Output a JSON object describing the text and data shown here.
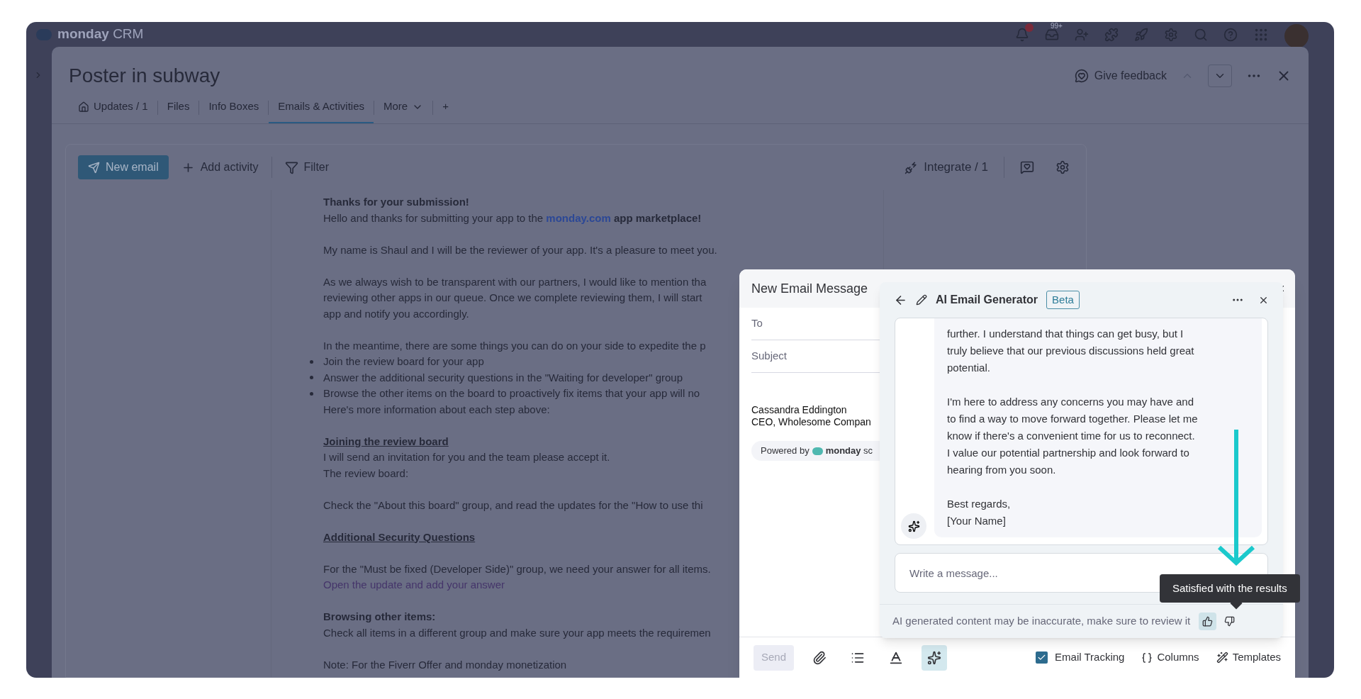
{
  "top_bar": {
    "brand": "monday",
    "product": "CRM",
    "inbox_badge": "99+"
  },
  "item": {
    "title": "Poster in subway",
    "feedback": "Give feedback"
  },
  "tabs": [
    {
      "label": "Updates / 1",
      "selected": false,
      "kind": "home"
    },
    {
      "label": "Files",
      "selected": false,
      "kind": "plain"
    },
    {
      "label": "Info Boxes",
      "selected": false,
      "kind": "plain"
    },
    {
      "label": "Emails & Activities",
      "selected": true,
      "kind": "plain"
    },
    {
      "label": "More",
      "selected": false,
      "kind": "dropdown"
    },
    {
      "label": "+",
      "selected": false,
      "kind": "plain"
    }
  ],
  "toolbar": {
    "new_email": "New email",
    "add_activity": "Add activity",
    "filter": "Filter",
    "integrate": "Integrate / 1"
  },
  "email_body": [
    {
      "lines": [
        {
          "kind": "bold",
          "text": "Thanks for your submission!"
        },
        {
          "kind": "runs",
          "runs": [
            {
              "kind": "plain",
              "text": "Hello and thanks for submitting your app to the "
            },
            {
              "kind": "link",
              "text": "monday.com"
            },
            {
              "kind": "bold",
              "text": " app marketplace!"
            }
          ]
        }
      ]
    },
    {
      "lines": [
        {
          "kind": "text",
          "text": "My name is Shaul and I will be the reviewer of your app. It's a pleasure to meet you."
        }
      ]
    },
    {
      "lines": [
        {
          "kind": "text",
          "text": "As we always wish to be transparent with our partners, I would like to mention tha"
        },
        {
          "kind": "text",
          "text": "reviewing other apps in our queue. Once we complete reviewing them, I will start"
        },
        {
          "kind": "text",
          "text": "app and notify you accordingly."
        }
      ]
    },
    {
      "lines": [
        {
          "kind": "text",
          "text": "In the meantime, there are some things you can do on your side to expedite the p"
        },
        {
          "kind": "bullet",
          "text": "Join the review board for your app"
        },
        {
          "kind": "bullet",
          "text": "Answer the additional security questions in the \"Waiting for developer\" group"
        },
        {
          "kind": "bullet",
          "text": "Browse the other items on the board to proactively fix items that your app will no"
        },
        {
          "kind": "text",
          "text": "Here's more information about each step above:"
        }
      ]
    },
    {
      "lines": [
        {
          "kind": "heading",
          "text": "Joining the review board"
        },
        {
          "kind": "text",
          "text": "I will send an invitation for you and the team please accept it."
        },
        {
          "kind": "text",
          "text": "The review board:"
        }
      ]
    },
    {
      "lines": [
        {
          "kind": "text",
          "text": "Check the \"About this board\" group, and read the updates for the \"How to use thi"
        }
      ]
    },
    {
      "lines": [
        {
          "kind": "heading",
          "text": "Additional Security Questions"
        }
      ]
    },
    {
      "lines": [
        {
          "kind": "text",
          "text": "For the \"Must be fixed (Developer Side)\" group, we need your answer for all items."
        },
        {
          "kind": "link",
          "text": "Open the update and add your answer"
        }
      ]
    },
    {
      "lines": [
        {
          "kind": "bold",
          "text": "Browsing other items:"
        },
        {
          "kind": "text",
          "text": "Check all items in a different group and make sure your app meets the requiremen"
        }
      ]
    },
    {
      "lines": [
        {
          "kind": "text",
          "text": "Note: For the Fiverr Offer and monday monetization"
        }
      ]
    }
  ],
  "composer": {
    "title": "New Email Message",
    "fields": [
      {
        "label": "To"
      },
      {
        "label": "Subject"
      }
    ],
    "signature": [
      "Cassandra Eddington",
      "CEO, Wholesome Compan"
    ],
    "powered_by": {
      "label": "Powered by",
      "brand": "**monday** sc"
    },
    "send": {
      "label": "Send",
      "disabled": true
    },
    "tools": [
      {
        "kind": "attach",
        "selected": false
      },
      {
        "kind": "list",
        "selected": false
      },
      {
        "kind": "text_color",
        "selected": false
      },
      {
        "kind": "ai",
        "selected": true
      }
    ],
    "email_tracking": {
      "label": "Email Tracking",
      "checked": true
    },
    "columns": "Columns",
    "templates": "Templates"
  },
  "ai_panel": {
    "title": "AI Email Generator",
    "badge": "Beta",
    "message": [
      [
        "further. I understand that things can get busy, but I",
        "truly believe that our previous discussions held great",
        "potential."
      ],
      [
        "I'm here to address any concerns you may have and",
        "to find a way to move forward together. Please let me",
        "know if there's a convenient time for us to reconnect.",
        "I value our potential partnership and look forward to",
        "hearing from you soon."
      ],
      [
        "Best regards,",
        "[Your Name]"
      ]
    ],
    "input": {
      "placeholder": "Write a message..."
    },
    "disclaimer": "AI generated content may be inaccurate, make sure to review it",
    "feedback": [
      {
        "kind": "up",
        "selected": true
      },
      {
        "kind": "down",
        "selected": false
      }
    ]
  },
  "tooltip": "Satisfied with the results"
}
